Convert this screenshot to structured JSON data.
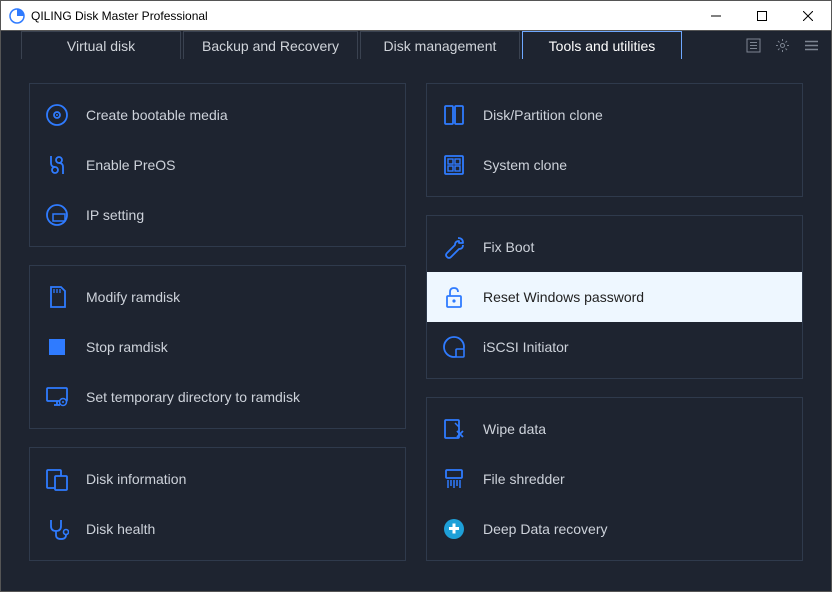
{
  "window": {
    "title": "QILING Disk Master Professional"
  },
  "tabs": [
    {
      "label": "Virtual disk",
      "selected": false
    },
    {
      "label": "Backup and Recovery",
      "selected": false
    },
    {
      "label": "Disk management",
      "selected": false
    },
    {
      "label": "Tools and utilities",
      "selected": true
    }
  ],
  "left_panels": [
    {
      "items": [
        {
          "label": "Create bootable media"
        },
        {
          "label": "Enable PreOS"
        },
        {
          "label": "IP setting"
        }
      ]
    },
    {
      "items": [
        {
          "label": "Modify ramdisk"
        },
        {
          "label": "Stop ramdisk"
        },
        {
          "label": "Set temporary directory to ramdisk"
        }
      ]
    },
    {
      "items": [
        {
          "label": "Disk information"
        },
        {
          "label": "Disk health"
        }
      ]
    }
  ],
  "right_panels": [
    {
      "items": [
        {
          "label": "Disk/Partition clone"
        },
        {
          "label": "System clone"
        }
      ]
    },
    {
      "items": [
        {
          "label": "Fix Boot"
        },
        {
          "label": "Reset Windows password",
          "selected": true
        },
        {
          "label": "iSCSI Initiator"
        }
      ]
    },
    {
      "items": [
        {
          "label": "Wipe data"
        },
        {
          "label": "File shredder"
        },
        {
          "label": "Deep Data recovery"
        }
      ]
    }
  ]
}
